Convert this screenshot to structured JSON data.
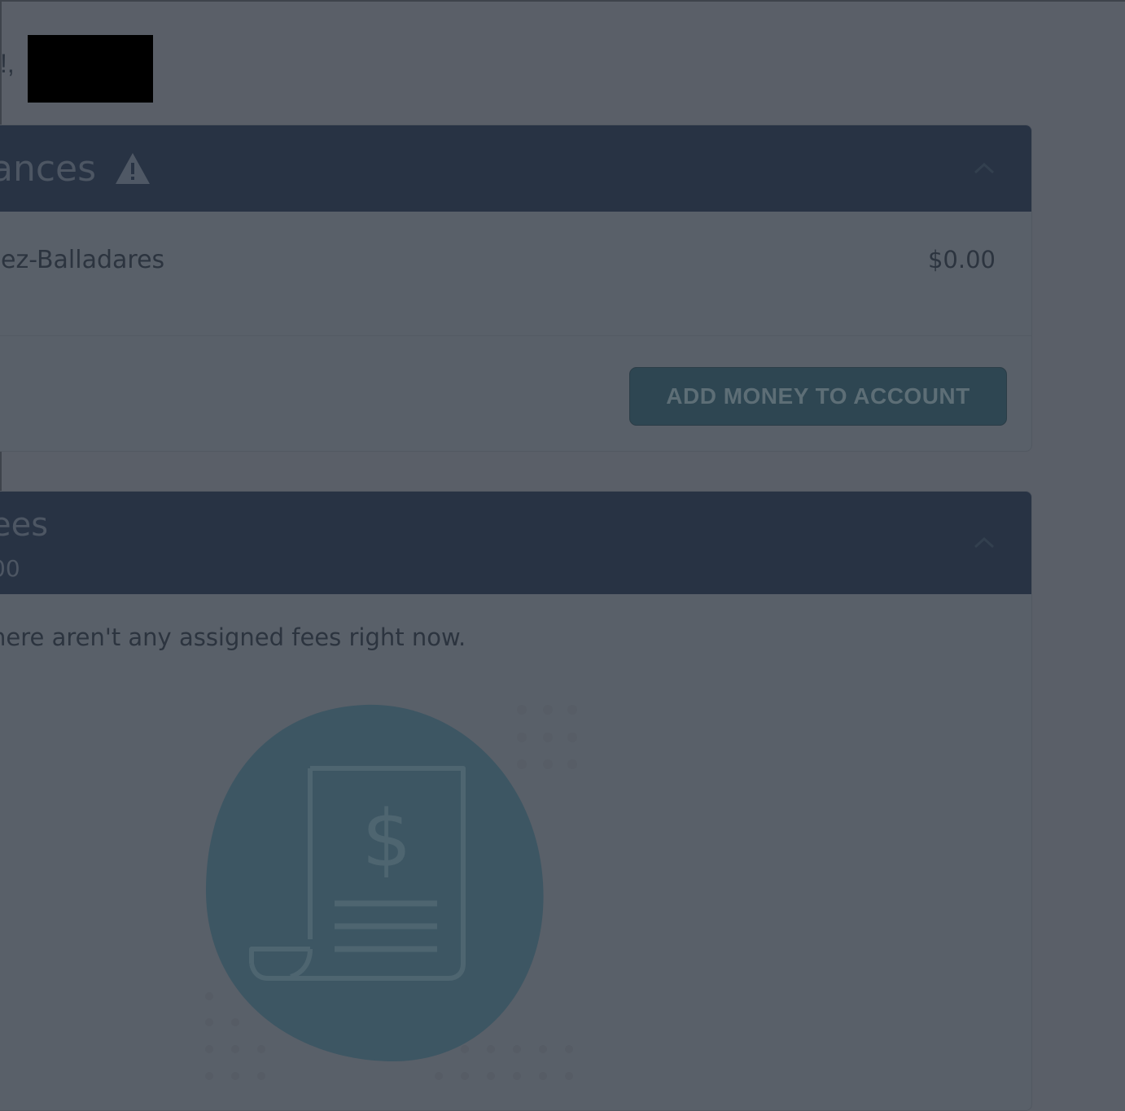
{
  "greeting": {
    "text": "!,"
  },
  "balances": {
    "title": "ances",
    "student_name": "ez-Balladares",
    "amount": "$0.00",
    "add_money_label": "ADD MONEY TO ACCOUNT"
  },
  "fees": {
    "title": "ees",
    "total": "00",
    "empty_message": "here aren't any assigned fees right now."
  },
  "colors": {
    "page_overlay": "#5a5f68",
    "card_header": "#283344",
    "button": "#2e4652",
    "illustration_blob": "#3d5663"
  },
  "icons": [
    "warning-icon",
    "chevron-up-icon",
    "receipt-dollar-icon"
  ]
}
